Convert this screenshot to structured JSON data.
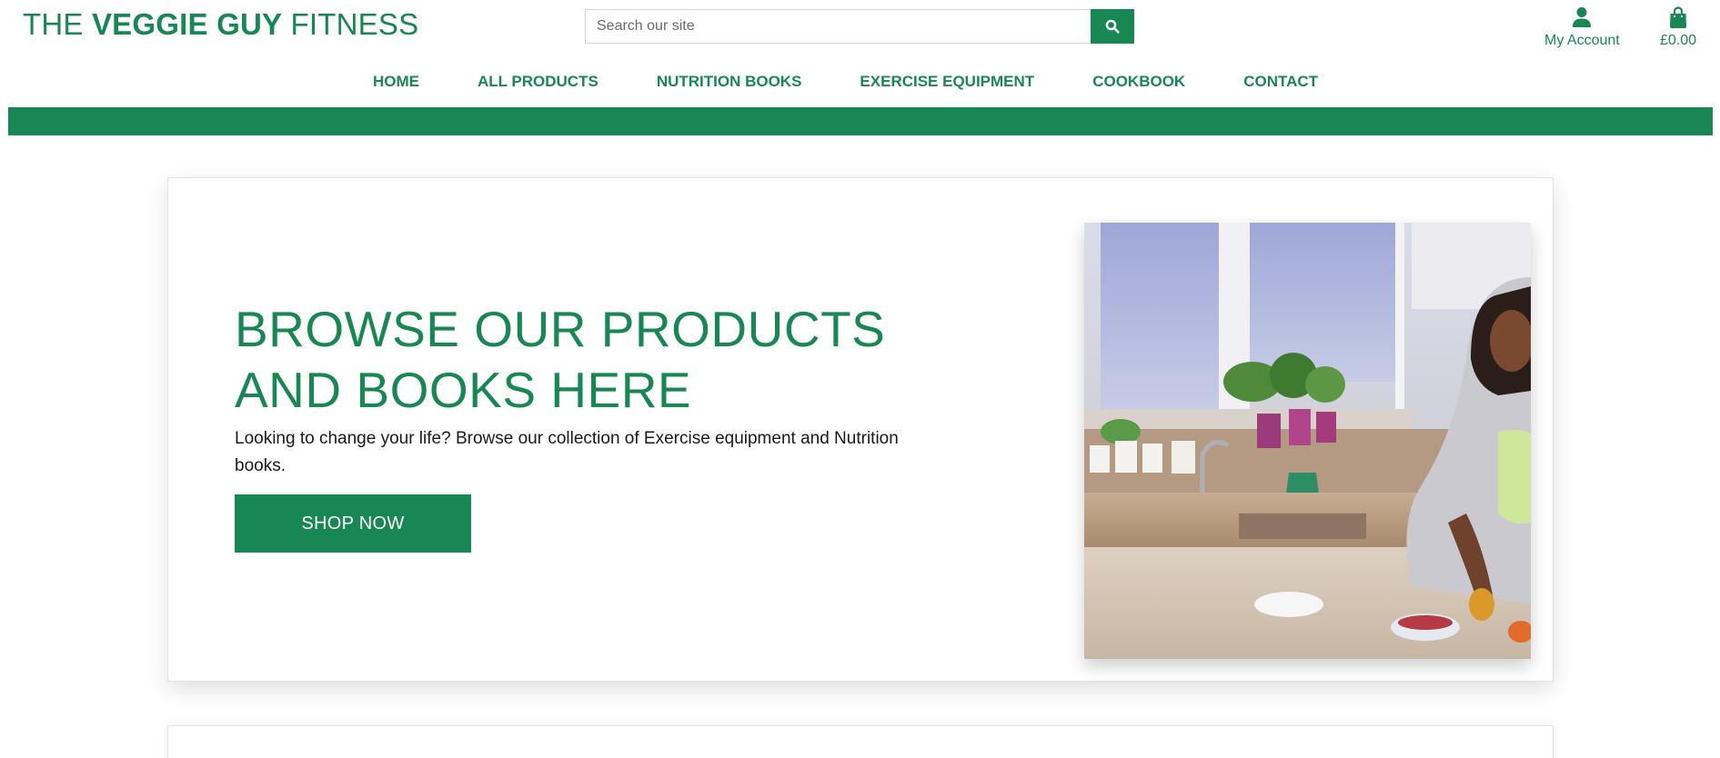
{
  "header": {
    "logo": {
      "prefix": "THE ",
      "bold": "VEGGIE GUY",
      "suffix": " FITNESS"
    },
    "search": {
      "placeholder": "Search our site",
      "value": "",
      "button_icon": "search-icon"
    },
    "account": {
      "label": "My Account",
      "icon": "user-icon"
    },
    "bag": {
      "total": "£0.00",
      "icon": "shopping-bag-icon"
    }
  },
  "nav": {
    "items": [
      {
        "label": "HOME"
      },
      {
        "label": "ALL PRODUCTS"
      },
      {
        "label": "NUTRITION BOOKS"
      },
      {
        "label": "EXERCISE EQUIPMENT"
      },
      {
        "label": "COOKBOOK"
      },
      {
        "label": "CONTACT"
      }
    ]
  },
  "hero": {
    "title_line1": "BROWSE OUR PRODUCTS",
    "title_line2": "AND BOOKS HERE",
    "text": "Looking to change your life? Browse our collection of Exercise equipment and Nutrition books.",
    "button": "SHOP NOW"
  },
  "colors": {
    "brand": "#198754",
    "text": "#1a1a1a"
  }
}
